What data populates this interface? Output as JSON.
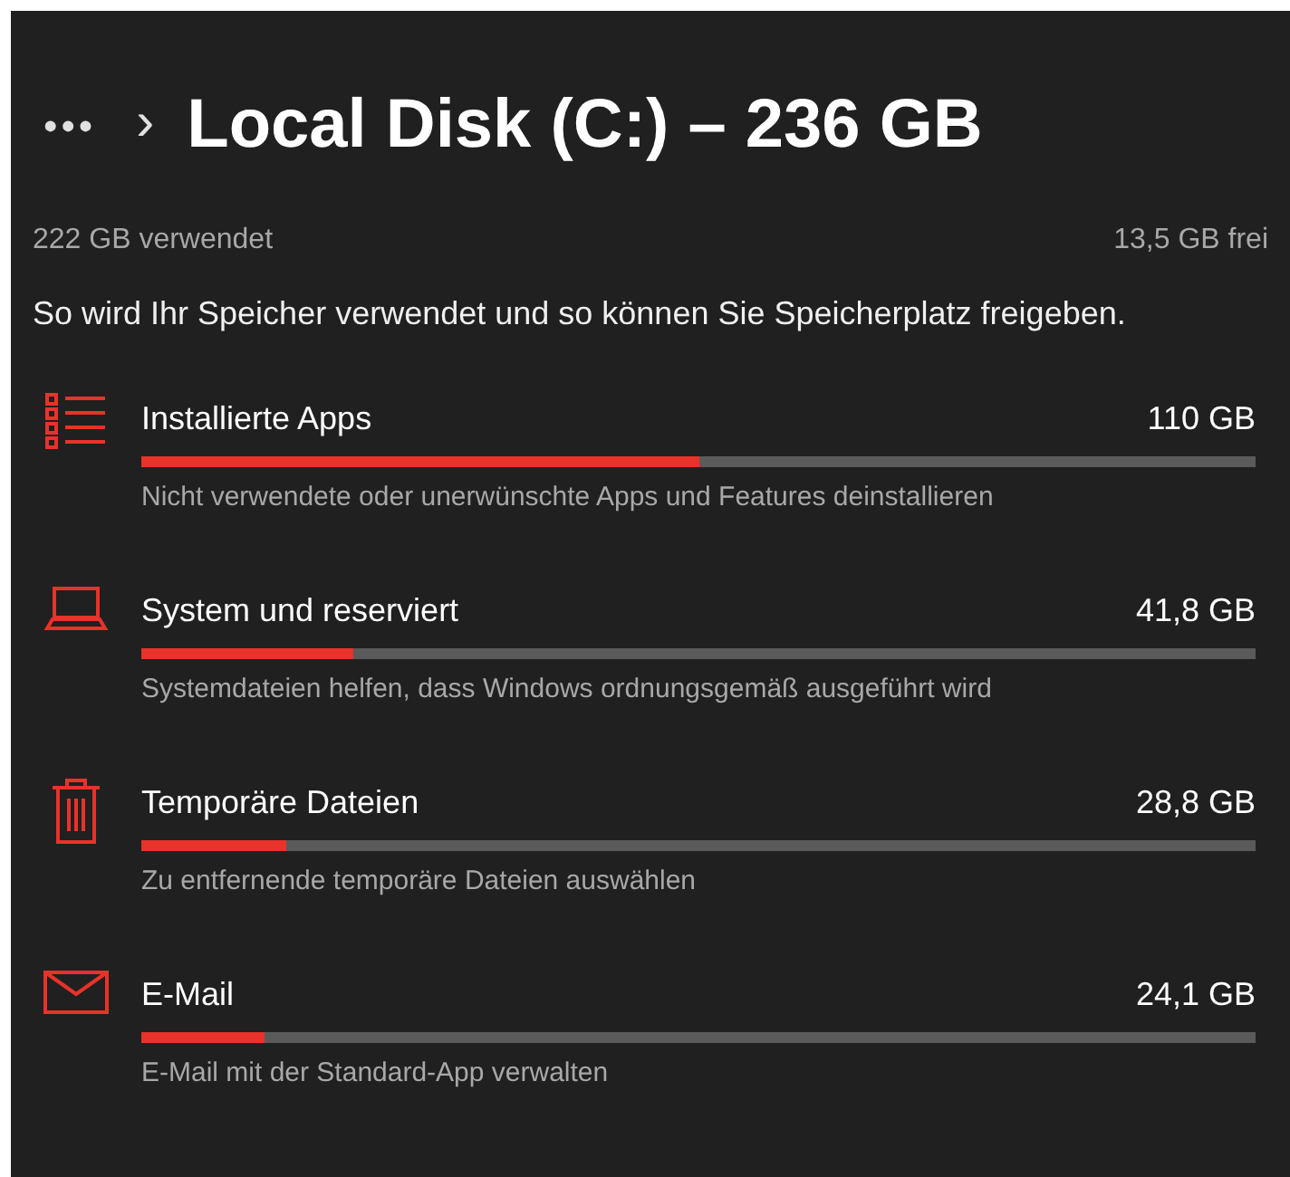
{
  "breadcrumb": {
    "overflow": "•••",
    "separator": "›",
    "title": "Local Disk (C:) – 236 GB"
  },
  "usage": {
    "used": "222 GB verwendet",
    "free": "13,5 GB frei"
  },
  "description": "So wird Ihr Speicher verwendet und so können Sie Speicherplatz freigeben.",
  "categories": [
    {
      "kind": "apps",
      "name": "Installierte Apps",
      "size": "110 GB",
      "level": 0.5,
      "hint": "Nicht verwendete oder unerwünschte Apps und Features deinstallieren"
    },
    {
      "kind": "system",
      "name": "System und reserviert",
      "size": "41,8 GB",
      "level": 0.19,
      "hint": "Systemdateien helfen, dass Windows ordnungsgemäß ausgeführt wird"
    },
    {
      "kind": "temp",
      "name": "Temporäre Dateien",
      "size": "28,8 GB",
      "level": 0.13,
      "hint": "Zu entfernende temporäre Dateien auswählen"
    },
    {
      "kind": "mail",
      "name": "E-Mail",
      "size": "24,1 GB",
      "level": 0.11,
      "hint": "E-Mail mit der Standard-App verwalten"
    }
  ]
}
